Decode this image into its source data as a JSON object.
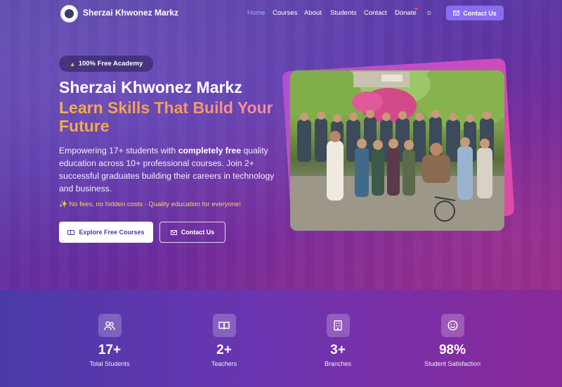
{
  "brand": {
    "name": "Sherzai Khwonez Markz",
    "logo_icon": "school-seal-icon"
  },
  "nav": {
    "items": [
      {
        "label": "Home",
        "active": true
      },
      {
        "label": "Courses"
      },
      {
        "label": "About"
      },
      {
        "label": "Students"
      },
      {
        "label": "Contact"
      },
      {
        "label": "Donate"
      }
    ],
    "donate_icon": "heart-icon",
    "theme_toggle_icon": "sun-icon",
    "cta_label": "Contact Us",
    "active_color": "#9ab0ff",
    "cta_color": "#8a6cf0"
  },
  "hero": {
    "badge": "100% Free Academy",
    "badge_icon": "graduation-cap-icon",
    "title": "Sherzai Khwonez Markz",
    "subtitle": "Learn Skills That Build Your Future",
    "desc_prefix": "Empowering 17+ students with ",
    "desc_bold": "completely free",
    "desc_suffix": " quality education across 10+ professional courses. Join 2+ successful graduates building their careers in technology and business.",
    "note": "✨ No fees, no hidden costs - Quality education for everyone!",
    "primary_button": "Explore Free Courses",
    "primary_icon": "book-open-icon",
    "secondary_button": "Contact Us",
    "secondary_icon": "mail-icon",
    "photo_alt": "group-photo-students"
  },
  "stats": [
    {
      "icon": "users-icon",
      "value": "17+",
      "label": "Total Students"
    },
    {
      "icon": "book-open-icon",
      "value": "2+",
      "label": "Teachers"
    },
    {
      "icon": "building-icon",
      "value": "3+",
      "label": "Branches"
    },
    {
      "icon": "smile-icon",
      "value": "98%",
      "label": "Student Satisfaction"
    }
  ]
}
